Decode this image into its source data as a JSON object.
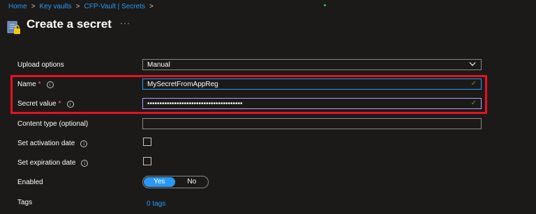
{
  "breadcrumb": {
    "items": [
      "Home",
      "Key vaults",
      "CFP-Vault | Secrets"
    ],
    "separator": ">"
  },
  "page": {
    "title": "Create a secret",
    "more_label": "···"
  },
  "form": {
    "upload_options": {
      "label": "Upload options",
      "value": "Manual"
    },
    "name": {
      "label": "Name",
      "required_mark": "*",
      "value": "MySecretFromAppReg"
    },
    "secret_value": {
      "label": "Secret value",
      "required_mark": "*",
      "masked": "•••••••••••••••••••••••••••••••••••••••"
    },
    "content_type": {
      "label": "Content type (optional)",
      "value": ""
    },
    "activation": {
      "label": "Set activation date",
      "checked": false
    },
    "expiration": {
      "label": "Set expiration date",
      "checked": false
    },
    "enabled": {
      "label": "Enabled",
      "yes": "Yes",
      "no": "No",
      "selected": "Yes"
    },
    "tags": {
      "label": "Tags",
      "link": "0 tags"
    }
  },
  "colors": {
    "background": "#1b1a19",
    "accent": "#2899f5",
    "valid": "#57a300",
    "highlight": "#e81123",
    "required": "#f1707b"
  },
  "icons": {
    "info": "info-icon",
    "check": "checkmark-icon",
    "chevron": "chevron-down-icon",
    "key_vault": "key-vault-secret-icon"
  }
}
